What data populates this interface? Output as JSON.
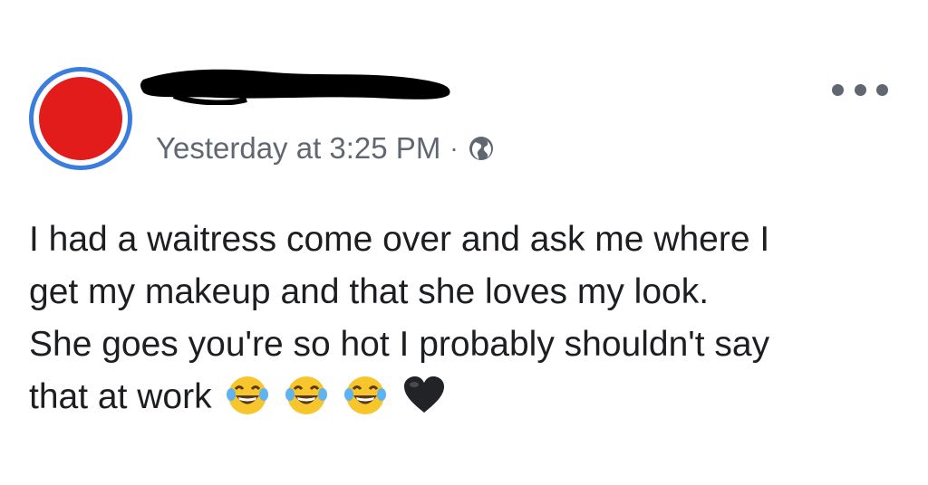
{
  "post": {
    "author": {
      "name_redacted": true
    },
    "timestamp": "Yesterday at 3:25 PM",
    "separator": "·",
    "privacy_icon": "globe-icon",
    "more_icon": "more-options-icon",
    "text_lines": [
      "I had a waitress come over and ask me where I",
      "get my makeup and that she loves my look.",
      "She goes you're so hot I probably shouldn't say",
      "that at work"
    ],
    "emojis": [
      "laughing-crying-emoji",
      "laughing-crying-emoji",
      "laughing-crying-emoji",
      "black-heart-emoji"
    ]
  },
  "colors": {
    "avatar_fill": "#e21b1b",
    "avatar_ring": "#3b7ddd",
    "meta_text": "#606770",
    "body_text": "#1c1e21",
    "redaction": "#000000"
  }
}
